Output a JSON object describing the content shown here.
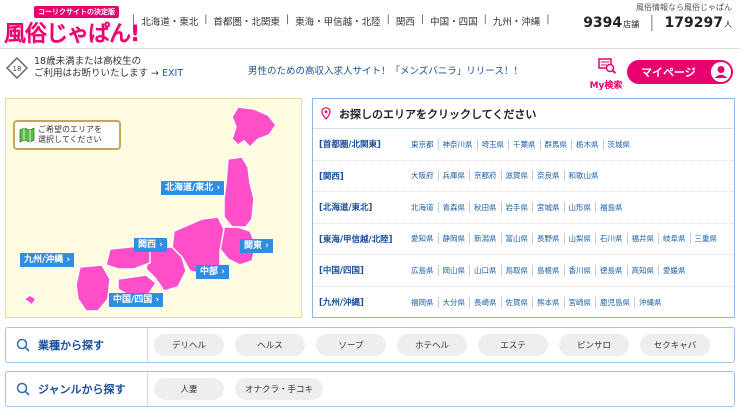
{
  "header": {
    "topnote": "風俗情報なら風俗じゃぱん",
    "logo_tag": "コーリクサイトの決定版",
    "logo_text": "風俗じゃぱん!",
    "nav": [
      "北海道・東北",
      "首都圏・北関東",
      "東海・甲信越・北陸",
      "関西",
      "中国・四国",
      "九州・沖縄"
    ],
    "shop_count": "9394",
    "shop_unit": "店舗",
    "member_count": "179297",
    "member_unit": "人"
  },
  "notice": {
    "line1": "18歳未満または高校生の",
    "line2": "ご利用はお断りいたします →",
    "exit": "EXIT"
  },
  "promo": "男性のための高収入求人サイト！「メンズバニラ」リリース！！",
  "mysearch_label": "My検索",
  "mypage_label": "マイページ",
  "map": {
    "note_line1": "ご希望のエリアを",
    "note_line2": "選択してください",
    "labels": {
      "hokkaido": "北海道/東北",
      "kanto": "関東",
      "chubu": "中部",
      "kansai": "関西",
      "chugoku": "中国/四国",
      "kyushu": "九州/沖縄"
    }
  },
  "area": {
    "heading": "お探しのエリアをクリックしてください",
    "rows": [
      {
        "name": "[首都圏/北関東]",
        "prefs": [
          "東京都",
          "神奈川県",
          "埼玉県",
          "千葉県",
          "群馬県",
          "栃木県",
          "茨城県"
        ]
      },
      {
        "name": "[関西]",
        "prefs": [
          "大阪府",
          "兵庫県",
          "京都府",
          "滋賀県",
          "奈良県",
          "和歌山県"
        ]
      },
      {
        "name": "[北海道/東北]",
        "prefs": [
          "北海道",
          "青森県",
          "秋田県",
          "岩手県",
          "宮城県",
          "山形県",
          "福島県"
        ]
      },
      {
        "name": "[東海/甲信越/北陸]",
        "prefs": [
          "愛知県",
          "静岡県",
          "新潟県",
          "富山県",
          "長野県",
          "山梨県",
          "石川県",
          "福井県",
          "岐阜県",
          "三重県"
        ]
      },
      {
        "name": "[中国/四国]",
        "prefs": [
          "広島県",
          "岡山県",
          "山口県",
          "鳥取県",
          "島根県",
          "香川県",
          "徳島県",
          "高知県",
          "愛媛県"
        ]
      },
      {
        "name": "[九州/沖縄]",
        "prefs": [
          "福岡県",
          "大分県",
          "長崎県",
          "佐賀県",
          "熊本県",
          "宮崎県",
          "鹿児島県",
          "沖縄県"
        ]
      }
    ]
  },
  "industry": {
    "label": "業種から探す",
    "chips": [
      "デリヘル",
      "ヘルス",
      "ソープ",
      "ホテヘル",
      "エステ",
      "ピンサロ",
      "セクキャバ"
    ]
  },
  "genre": {
    "label": "ジャンルから探す",
    "chips": [
      "人妻",
      "オナクラ・手コキ"
    ]
  },
  "colors": {
    "brand_pink": "#e8006e",
    "map_pink": "#ff4fc8",
    "label_blue": "#2f8de4",
    "link_blue": "#1a5eaa"
  }
}
